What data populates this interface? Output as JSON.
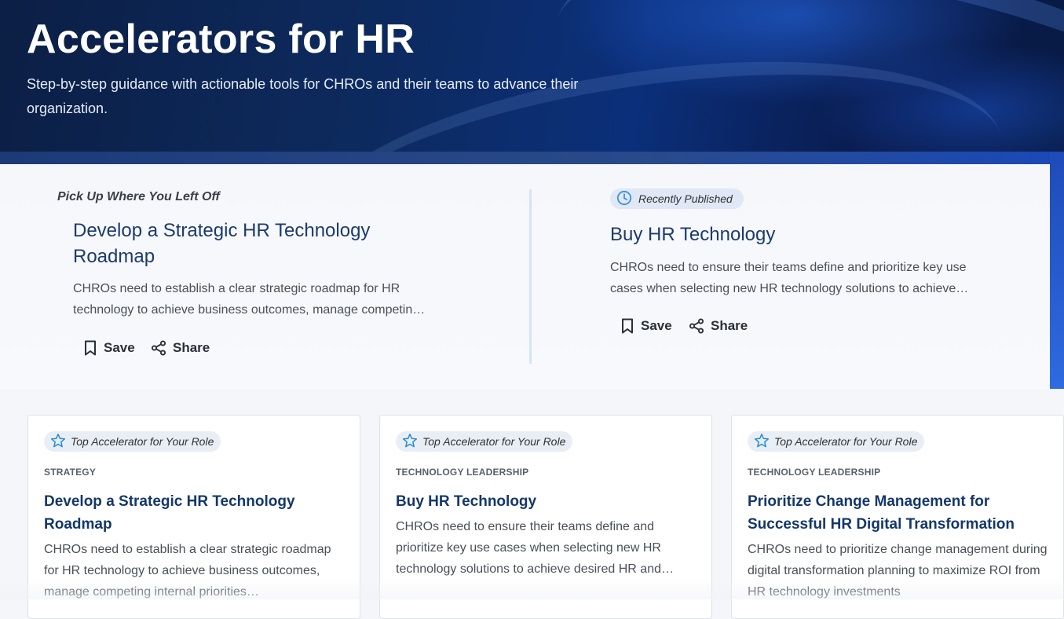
{
  "hero": {
    "title": "Accelerators for HR",
    "subtitle": "Step-by-step guidance with actionable tools for CHROs and their teams to advance their organization."
  },
  "featured": {
    "left": {
      "section_label": "Pick Up Where You Left Off",
      "title": "Develop a Strategic HR Technology Roadmap",
      "description": "CHROs need to establish a clear strategic roadmap for HR technology to achieve business outcomes, manage competin…",
      "save_label": "Save",
      "share_label": "Share"
    },
    "right": {
      "badge": "Recently Published",
      "badge_icon": "clock-icon",
      "title": "Buy HR Technology",
      "description": "CHROs need to ensure their teams define and prioritize key use cases when selecting new HR technology solutions to achieve…",
      "save_label": "Save",
      "share_label": "Share"
    }
  },
  "cards": [
    {
      "badge": "Top Accelerator for Your Role",
      "badge_icon": "star-icon",
      "category": "STRATEGY",
      "title": "Develop a Strategic HR Technology Roadmap",
      "description": "CHROs need to establish a clear strategic roadmap for HR technology to achieve business outcomes, manage competing internal priorities…"
    },
    {
      "badge": "Top Accelerator for Your Role",
      "badge_icon": "star-icon",
      "category": "TECHNOLOGY LEADERSHIP",
      "title": "Buy HR Technology",
      "description": "CHROs need to ensure their teams define and prioritize key use cases when selecting new HR technology solutions to achieve desired HR and…"
    },
    {
      "badge": "Top Accelerator for Your Role",
      "badge_icon": "star-icon",
      "category": "TECHNOLOGY LEADERSHIP",
      "title": "Prioritize Change Management for Successful HR Digital Transformation",
      "description": "CHROs need to prioritize change management during digital transformation planning to maximize ROI from HR technology investments"
    }
  ],
  "colors": {
    "hero_bg": "#0d2a5e",
    "title_blue": "#14376b",
    "badge_star": "#2a8ad8",
    "divider": "#d6e4f3"
  }
}
